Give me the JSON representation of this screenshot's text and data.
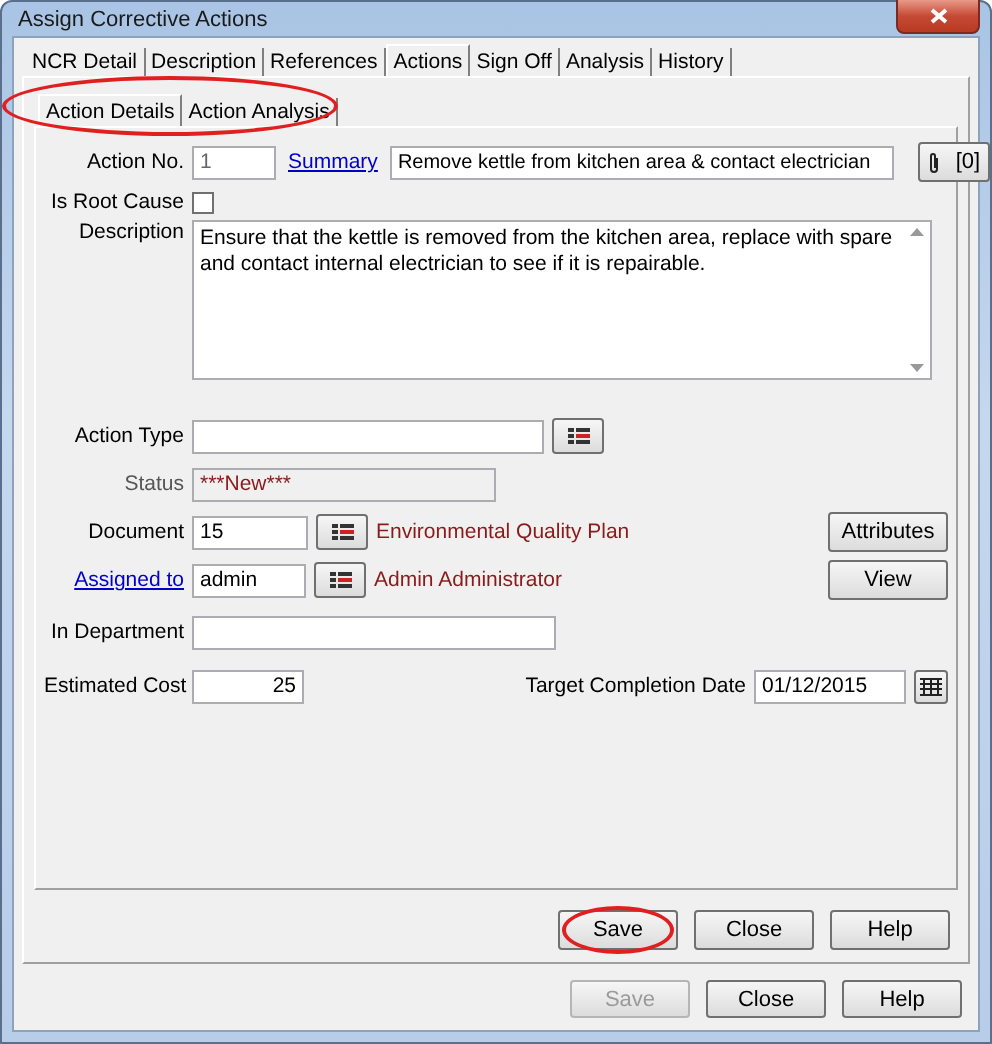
{
  "window": {
    "title": "Assign Corrective Actions"
  },
  "outer_tabs": [
    {
      "label": "NCR Detail",
      "selected": false
    },
    {
      "label": "Description",
      "selected": false
    },
    {
      "label": "References",
      "selected": false
    },
    {
      "label": "Actions",
      "selected": true
    },
    {
      "label": "Sign Off",
      "selected": false
    },
    {
      "label": "Analysis",
      "selected": false
    },
    {
      "label": "History",
      "selected": false
    }
  ],
  "inner_tabs": {
    "highlighted": true,
    "items": [
      {
        "label": "Action Details",
        "selected": true
      },
      {
        "label": "Action Analysis",
        "selected": false
      }
    ]
  },
  "form": {
    "action_no": {
      "label": "Action No.",
      "value": "1"
    },
    "summary": {
      "label": "Summary",
      "value": "Remove kettle from kitchen area & contact electrician"
    },
    "attachments": "[0]",
    "root_cause": {
      "label": "Is Root Cause",
      "checked": false
    },
    "description": {
      "label": "Description",
      "value": "Ensure that the kettle is removed from the kitchen area, replace with spare and contact internal electrician to see if it is repairable."
    },
    "action_type": {
      "label": "Action Type"
    },
    "status": {
      "label": "Status",
      "value": "***New***"
    },
    "document": {
      "label": "Document",
      "value": "15",
      "name": "Environmental Quality Plan"
    },
    "assigned_to": {
      "label": "Assigned to",
      "value": "admin",
      "name": "Admin Administrator"
    },
    "in_department": {
      "label": "In Department"
    },
    "estimated_cost": {
      "label": "Estimated Cost",
      "value": "25"
    },
    "target_date": {
      "label": "Target Completion Date",
      "value": "01/12/2015"
    }
  },
  "side_buttons": [
    "Attributes",
    "View"
  ],
  "panel_buttons": [
    {
      "label": "Save",
      "disabled": false,
      "highlighted": true
    },
    {
      "label": "Close",
      "disabled": false,
      "highlighted": false
    },
    {
      "label": "Help",
      "disabled": false,
      "highlighted": false
    }
  ],
  "dialog_buttons": [
    {
      "label": "Save",
      "disabled": true
    },
    {
      "label": "Close",
      "disabled": false
    },
    {
      "label": "Help",
      "disabled": false
    }
  ]
}
